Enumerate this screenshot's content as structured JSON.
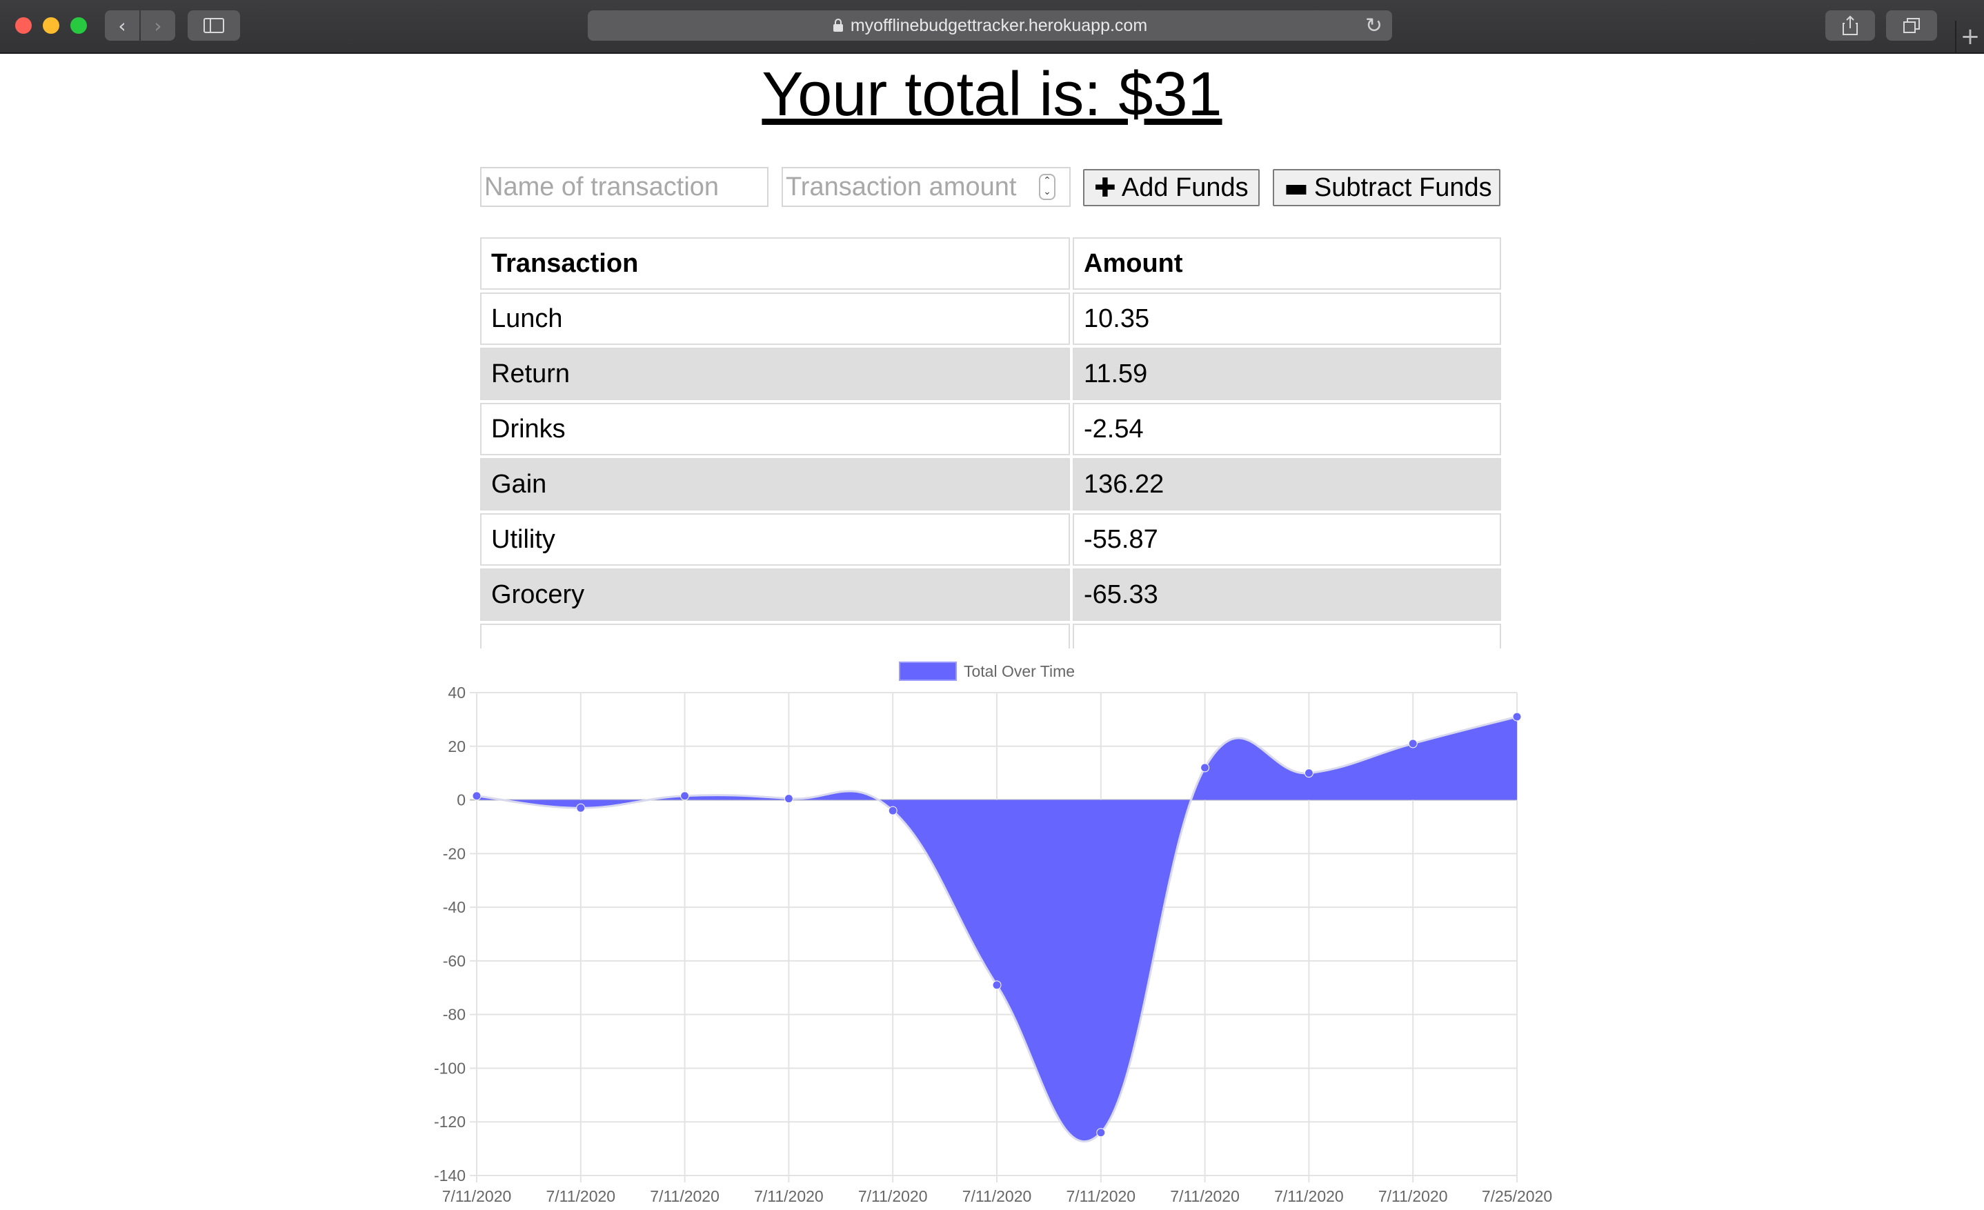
{
  "browser": {
    "url": "myofflinebudgettracker.herokuapp.com",
    "icons": {
      "back": "chevron-left-icon",
      "forward": "chevron-right-icon",
      "sidebar": "sidebar-icon",
      "lock": "lock-icon",
      "reload": "reload-icon",
      "share": "share-icon",
      "tabs": "tabs-overview-icon",
      "new_tab": "plus-icon"
    }
  },
  "page": {
    "total_text": "Your total is: $31",
    "form": {
      "name_placeholder": "Name of transaction",
      "amount_placeholder": "Transaction amount",
      "add_label": "Add Funds",
      "subtract_label": "Subtract Funds"
    },
    "table": {
      "headers": [
        "Transaction",
        "Amount"
      ],
      "rows": [
        {
          "name": "Lunch",
          "amount": "10.35"
        },
        {
          "name": "Return",
          "amount": "11.59"
        },
        {
          "name": "Drinks",
          "amount": "-2.54"
        },
        {
          "name": "Gain",
          "amount": "136.22"
        },
        {
          "name": "Utility",
          "amount": "-55.87"
        },
        {
          "name": "Grocery",
          "amount": "-65.33"
        }
      ]
    }
  },
  "chart_data": {
    "type": "area",
    "legend": "Total Over Time",
    "legend_position": "top",
    "color": "#6666ff",
    "x": [
      "7/11/2020",
      "7/11/2020",
      "7/11/2020",
      "7/11/2020",
      "7/11/2020",
      "7/11/2020",
      "7/11/2020",
      "7/11/2020",
      "7/11/2020",
      "7/11/2020",
      "7/25/2020"
    ],
    "values": [
      1.5,
      -3,
      1.5,
      0.5,
      -4,
      -69,
      -124,
      12,
      10,
      21,
      31
    ],
    "ylim": [
      -140,
      40
    ],
    "yticks": [
      40,
      20,
      0,
      -20,
      -40,
      -60,
      -80,
      -100,
      -120,
      -140
    ],
    "grid": true
  }
}
